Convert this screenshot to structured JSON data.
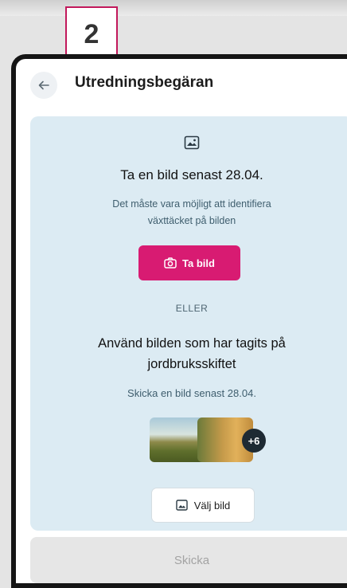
{
  "step_number": "2",
  "header": {
    "title": "Utredningsbegäran"
  },
  "request": {
    "heading": "Ta en bild senast 28.04.",
    "description_line1": "Det måste vara möjligt att identifiera",
    "description_line2": "växttäcket på bilden",
    "take_photo_label": "Ta bild",
    "or_label": "ELLER",
    "alt_heading_line1": "Använd bilden som har tagits på",
    "alt_heading_line2": "jordbruksskiftet",
    "alt_description": "Skicka en bild senast 28.04.",
    "more_count": "+6",
    "choose_photo_label": "Välj bild"
  },
  "footer": {
    "send_label": "Skicka"
  },
  "colors": {
    "accent": "#d81b72",
    "card_background": "#dcebf3",
    "step_border": "#c2185b",
    "disabled_button": "#e6e6e6"
  },
  "icons": {
    "back": "arrow-left-icon",
    "image": "image-icon",
    "camera": "camera-icon",
    "gallery": "gallery-icon"
  }
}
